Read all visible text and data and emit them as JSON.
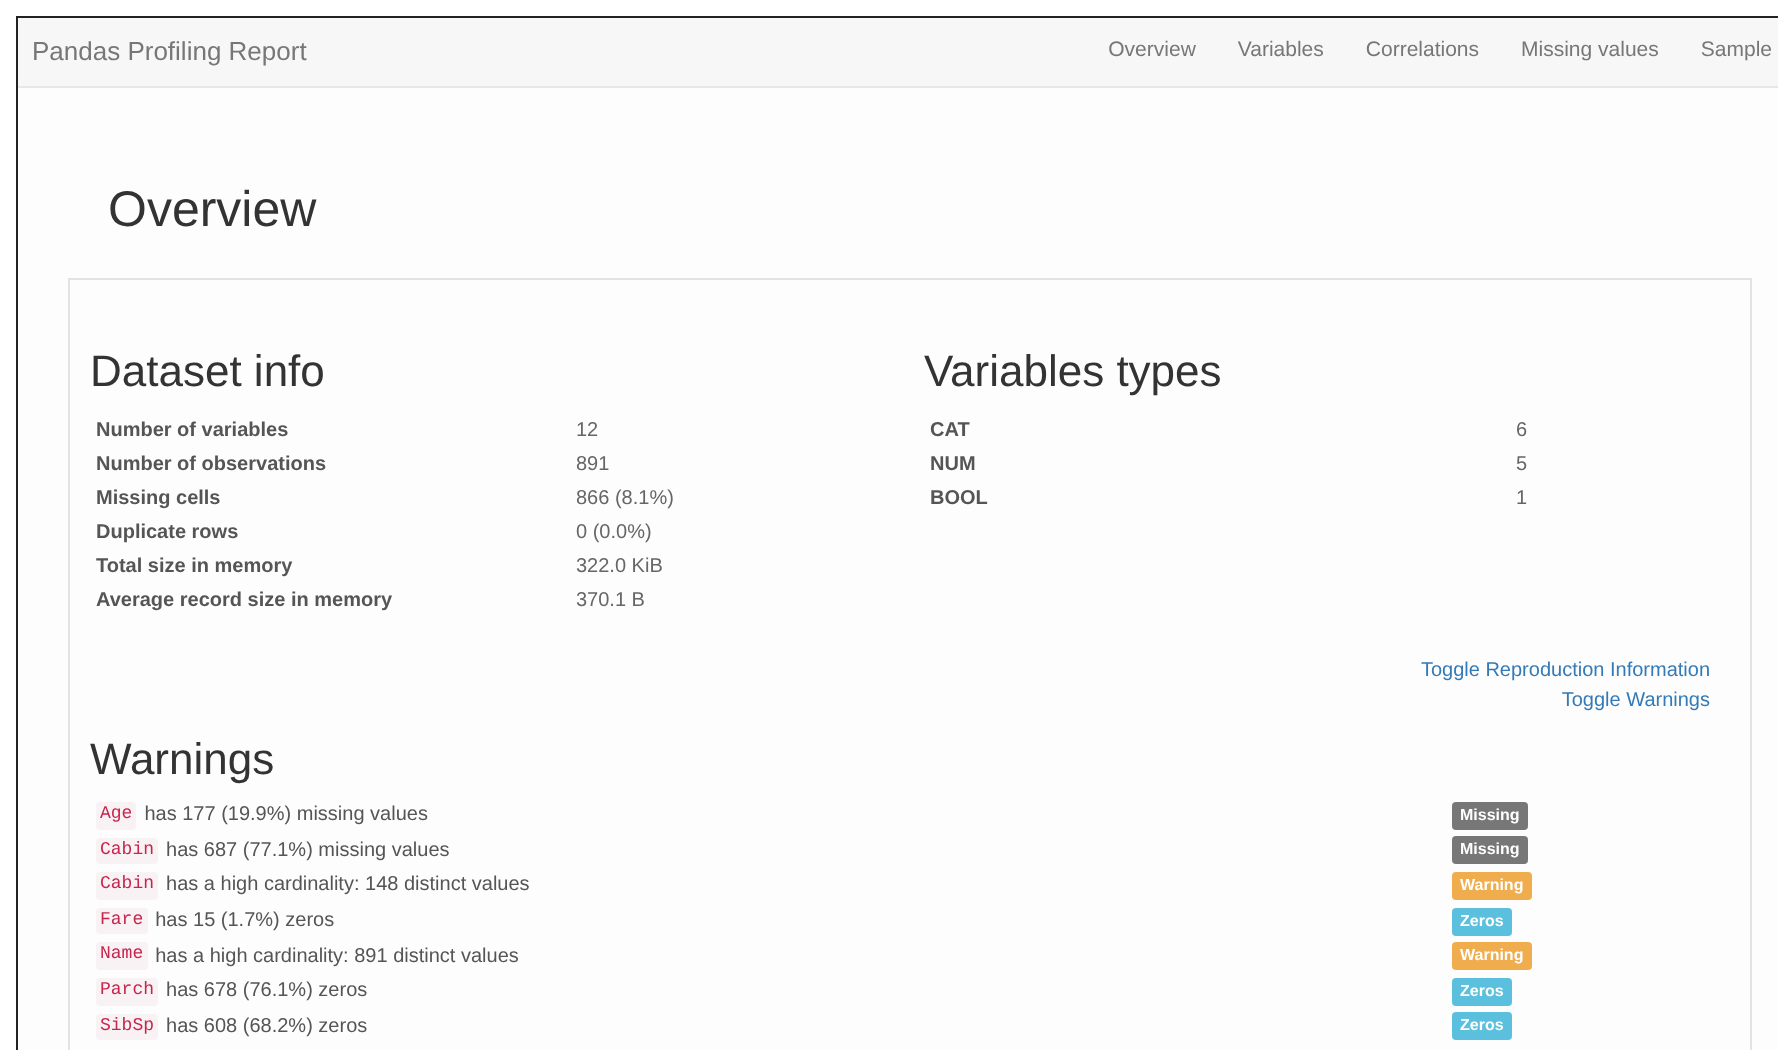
{
  "navbar": {
    "brand": "Pandas Profiling Report",
    "links": [
      "Overview",
      "Variables",
      "Correlations",
      "Missing values",
      "Sample"
    ]
  },
  "page_title": "Overview",
  "dataset_info": {
    "title": "Dataset info",
    "rows": [
      {
        "label": "Number of variables",
        "value": "12"
      },
      {
        "label": "Number of observations",
        "value": "891"
      },
      {
        "label": "Missing cells",
        "value": "866 (8.1%)"
      },
      {
        "label": "Duplicate rows",
        "value": "0 (0.0%)"
      },
      {
        "label": "Total size in memory",
        "value": "322.0 KiB"
      },
      {
        "label": "Average record size in memory",
        "value": "370.1 B"
      }
    ]
  },
  "variables_types": {
    "title": "Variables types",
    "rows": [
      {
        "label": "CAT",
        "value": "6"
      },
      {
        "label": "NUM",
        "value": "5"
      },
      {
        "label": "BOOL",
        "value": "1"
      }
    ]
  },
  "toggles": [
    "Toggle Reproduction Information",
    "Toggle Warnings"
  ],
  "warnings": {
    "title": "Warnings",
    "items": [
      {
        "variable": "Age",
        "text": "has 177 (19.9%) missing values",
        "badge": "Missing",
        "kind": "missing"
      },
      {
        "variable": "Cabin",
        "text": "has 687 (77.1%) missing values",
        "badge": "Missing",
        "kind": "missing"
      },
      {
        "variable": "Cabin",
        "text": "has a high cardinality: 148 distinct values",
        "badge": "Warning",
        "kind": "warning"
      },
      {
        "variable": "Fare",
        "text": "has 15 (1.7%) zeros",
        "badge": "Zeros",
        "kind": "zeros"
      },
      {
        "variable": "Name",
        "text": "has a high cardinality: 891 distinct values",
        "badge": "Warning",
        "kind": "warning"
      },
      {
        "variable": "Parch",
        "text": "has 678 (76.1%) zeros",
        "badge": "Zeros",
        "kind": "zeros"
      },
      {
        "variable": "SibSp",
        "text": "has 608 (68.2%) zeros",
        "badge": "Zeros",
        "kind": "zeros"
      }
    ]
  }
}
